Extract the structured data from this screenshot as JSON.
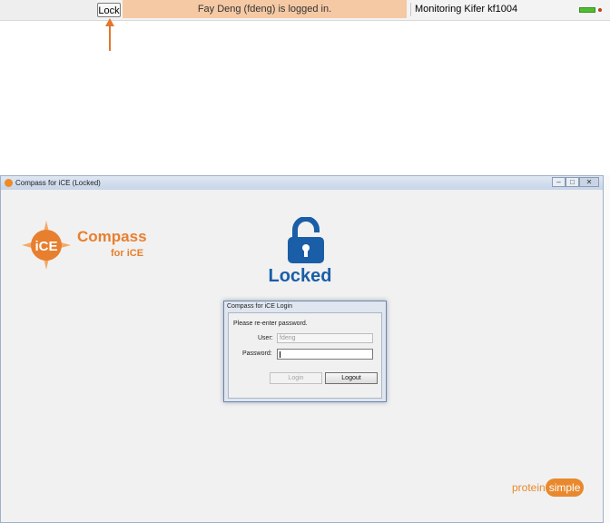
{
  "statusbar": {
    "lock_label": "Lock",
    "message": "Fay Deng (fdeng) is logged in.",
    "monitoring": "Monitoring Kifer kf1004",
    "status_color": "#4bbf2f"
  },
  "window": {
    "title": "Compass for iCE (Locked)",
    "controls": {
      "minimize": "–",
      "maximize": "□",
      "close": "✕"
    }
  },
  "logo": {
    "mark_text": "iCE",
    "product": "Compass",
    "subtitle": "for iCE",
    "accent_color": "#e87f2e"
  },
  "lock": {
    "status_text": "Locked",
    "color": "#1a5ea8"
  },
  "login_dialog": {
    "title": "Compass for iCE Login",
    "prompt": "Please re-enter password.",
    "user_label": "User:",
    "user_value": "fdeng",
    "password_label": "Password:",
    "password_value": "",
    "login_button": "Login",
    "logout_button": "Logout"
  },
  "brand": {
    "part1": "protein",
    "part2": "simple",
    "color": "#e8892e"
  }
}
